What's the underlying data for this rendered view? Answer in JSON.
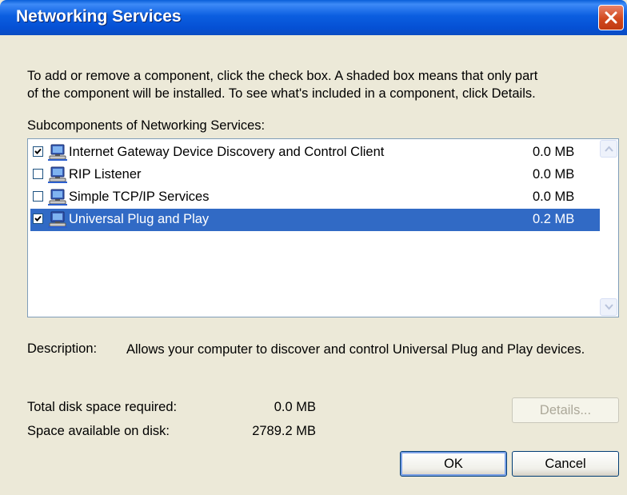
{
  "window": {
    "title": "Networking Services"
  },
  "intro": {
    "line1": "To add or remove a component, click the check box. A shaded box means that only part",
    "line2": "of the component will be installed. To see what's included in a component, click Details."
  },
  "subcomponents_label": "Subcomponents of Networking Services:",
  "components": [
    {
      "label": "Internet Gateway Device Discovery and Control Client",
      "size": "0.0 MB",
      "checked": true,
      "selected": false
    },
    {
      "label": "RIP Listener",
      "size": "0.0 MB",
      "checked": false,
      "selected": false
    },
    {
      "label": "Simple TCP/IP Services",
      "size": "0.0 MB",
      "checked": false,
      "selected": false
    },
    {
      "label": "Universal Plug and Play",
      "size": "0.2 MB",
      "checked": true,
      "selected": true
    }
  ],
  "description": {
    "label": "Description:",
    "text": "Allows your computer to discover and control Universal Plug and Play devices."
  },
  "disk": {
    "required_label": "Total disk space required:",
    "required_value": "0.0 MB",
    "available_label": "Space available on disk:",
    "available_value": "2789.2 MB"
  },
  "buttons": {
    "details": "Details...",
    "ok": "OK",
    "cancel": "Cancel"
  },
  "colors": {
    "titlebar": "#0a5fd8",
    "selection": "#316ac5",
    "dialog_bg": "#ece9d8",
    "close_button": "#d2491e"
  },
  "icons": {
    "close": "close-icon",
    "component": "computer-network-icon",
    "check": "checkmark-icon",
    "scroll_up": "chevron-up-icon",
    "scroll_down": "chevron-down-icon"
  }
}
